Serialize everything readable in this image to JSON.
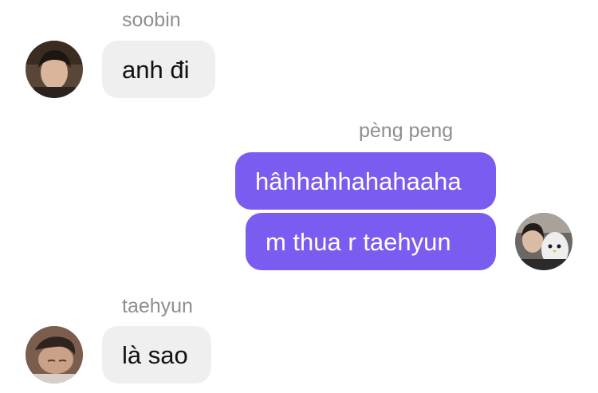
{
  "messages": [
    {
      "sender": "soobin",
      "side": "incoming",
      "avatar": "soobin-avatar",
      "texts": [
        "anh đi"
      ]
    },
    {
      "sender": "pèng peng",
      "side": "outgoing",
      "avatar": "peng-avatar",
      "texts": [
        "hâhhahhahahaaha",
        "m thua r taehyun"
      ]
    },
    {
      "sender": "taehyun",
      "side": "incoming",
      "avatar": "taehyun-avatar",
      "texts": [
        "là sao"
      ]
    }
  ],
  "colors": {
    "outgoing_bubble": "#7b5cf0",
    "incoming_bubble": "#efeff0",
    "sender_name": "#8e8e93"
  }
}
